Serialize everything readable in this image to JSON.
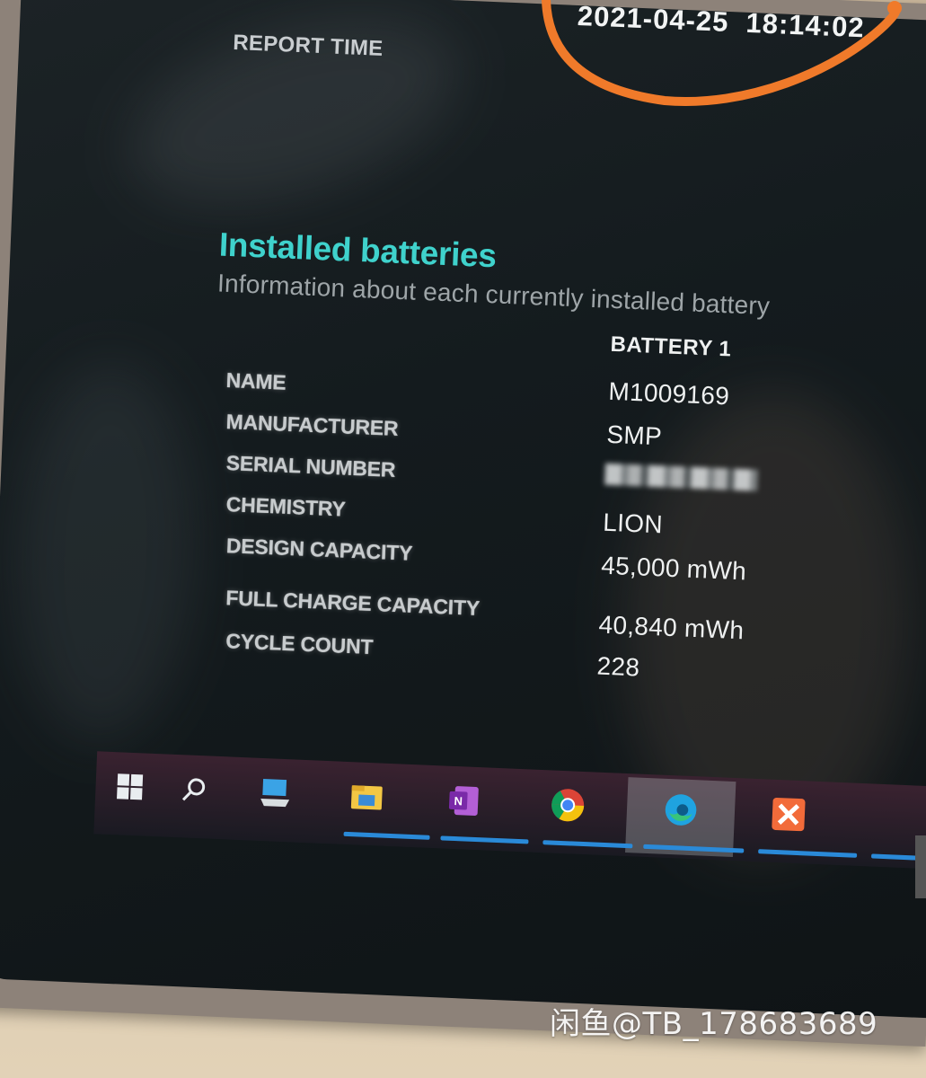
{
  "report": {
    "time_label": "REPORT TIME",
    "time_value": "2021-04-25  18:14:02"
  },
  "section": {
    "title": "Installed batteries",
    "subtitle": "Information about each currently installed battery"
  },
  "table": {
    "column_header": "BATTERY 1",
    "rows": [
      {
        "label": "NAME",
        "value": "M1009169"
      },
      {
        "label": "MANUFACTURER",
        "value": "SMP"
      },
      {
        "label": "SERIAL NUMBER",
        "value": ""
      },
      {
        "label": "CHEMISTRY",
        "value": "LION"
      },
      {
        "label": "DESIGN CAPACITY",
        "value": "45,000 mWh"
      },
      {
        "label": "FULL CHARGE CAPACITY",
        "value": "40,840 mWh"
      },
      {
        "label": "CYCLE COUNT",
        "value": "228"
      }
    ]
  },
  "taskbar": {
    "icons": [
      "windows-start-icon",
      "search-icon",
      "computer-icon",
      "file-explorer-icon",
      "onenote-icon",
      "chrome-icon",
      "edge-icon",
      "xmind-icon"
    ]
  },
  "watermark": "闲鱼@TB_178683689",
  "colors": {
    "accent": "#3fd2cc",
    "annotation": "#f07a2a",
    "taskbar_underline": "#2a8ad8"
  }
}
